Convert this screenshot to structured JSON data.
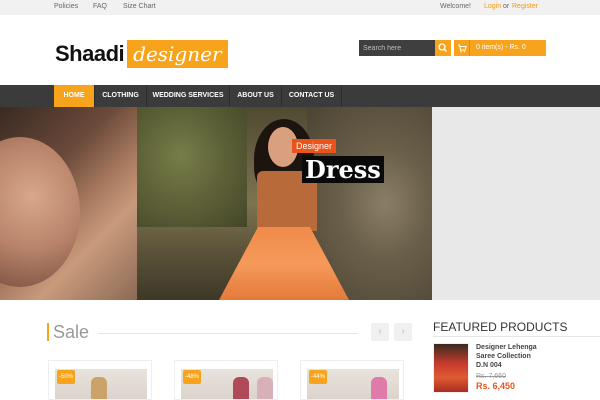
{
  "topbar": {
    "links": [
      "Policies",
      "FAQ",
      "Size Chart"
    ],
    "welcome": "Welcome!",
    "login": "Login",
    "or": "or",
    "register": "Register"
  },
  "header": {
    "logo_part1": "Shaadi",
    "logo_part2": "designer",
    "search_placeholder": "Search here",
    "cart_label": "0 item(s) - Rs. 0"
  },
  "nav": {
    "items": [
      "HOME",
      "CLOTHING",
      "WEDDING SERVICES",
      "ABOUT US",
      "CONTACT US"
    ],
    "active_index": 0
  },
  "banner": {
    "tag_small": "Designer",
    "tag_big": "Dress"
  },
  "sale": {
    "title": "Sale",
    "prev_icon": "chevron-left-icon",
    "next_icon": "chevron-right-icon",
    "cards": [
      {
        "badge": "-50%"
      },
      {
        "badge": "-48%"
      },
      {
        "badge": "-44%"
      }
    ]
  },
  "featured": {
    "title": "FEATURED PRODUCTS",
    "product": {
      "name": "Designer Lehenga Saree Collection D.N 004",
      "old_price": "Rs. 7,660",
      "new_price": "Rs. 6,450"
    }
  },
  "colors": {
    "accent": "#f7a41c",
    "nav_bg": "#3b3b3b",
    "sale_red": "#e8541c"
  }
}
